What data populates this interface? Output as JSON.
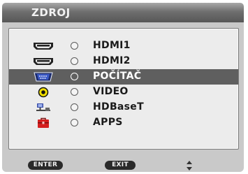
{
  "menu": {
    "title": "ZDROJ",
    "selected_index": 2,
    "sources": [
      {
        "label": "HDMI1",
        "icon": "hdmi-port-icon",
        "selected": false
      },
      {
        "label": "HDMI2",
        "icon": "hdmi-port-icon",
        "selected": false
      },
      {
        "label": "POČÍTAČ",
        "icon": "vga-port-icon",
        "selected": true
      },
      {
        "label": "VIDEO",
        "icon": "video-jack-icon",
        "selected": false
      },
      {
        "label": "HDBaseT",
        "icon": "hdbaset-network-icon",
        "selected": false
      },
      {
        "label": "APPS",
        "icon": "apps-toolbox-icon",
        "selected": false
      }
    ]
  },
  "footer": {
    "enter_label": "ENTER",
    "exit_label": "EXIT",
    "navigate_icon": "up-down-arrows-icon"
  },
  "colors": {
    "title_bar": "#6f6f6f",
    "frame": "#c9c9c9",
    "panel": "#ececec",
    "selection": "#5f5f5f",
    "pill": "#2a2a2a",
    "video_jack": "#f2e000",
    "apps_icon": "#d41f1f"
  }
}
